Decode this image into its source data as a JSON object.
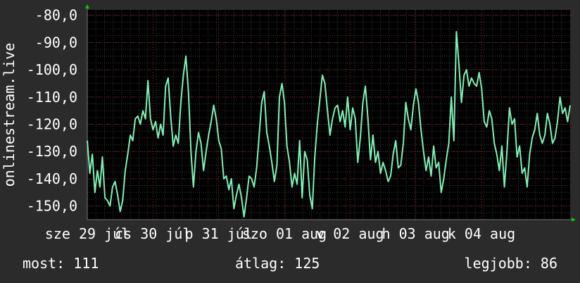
{
  "chart_data": {
    "type": "line",
    "ylabel": "onlinestream.live",
    "ylim": [
      -155,
      -78
    ],
    "y_ticks": [
      -80,
      -90,
      -100,
      -110,
      -120,
      -130,
      -140,
      -150
    ],
    "y_tick_labels": [
      "-80,0",
      "-90,0",
      "-100,0",
      "-110,0",
      "-120,0",
      "-130,0",
      "-140,0",
      "-150,0"
    ],
    "x_tick_labels": [
      "sze 29 júl",
      "cs 30 júl",
      "p 31 júl",
      "szo 01 aug",
      "v 02 aug",
      "h 03 aug",
      "k 04 aug"
    ],
    "grid": true,
    "series": [
      {
        "color": "#7ef2b6",
        "values": [
          -126,
          -138,
          -131,
          -145,
          -137,
          -143,
          -132,
          -147,
          -148,
          -150,
          -143,
          -141,
          -146,
          -152,
          -148,
          -137,
          -131,
          -124,
          -126,
          -118,
          -117,
          -120,
          -115,
          -118,
          -104,
          -118,
          -122,
          -119,
          -125,
          -120,
          -124,
          -106,
          -103,
          -117,
          -128,
          -124,
          -127,
          -112,
          -102,
          -95,
          -108,
          -130,
          -143,
          -130,
          -123,
          -127,
          -137,
          -130,
          -124,
          -119,
          -113,
          -118,
          -126,
          -129,
          -140,
          -139,
          -144,
          -140,
          -151,
          -146,
          -142,
          -147,
          -154,
          -147,
          -139,
          -140,
          -143,
          -136,
          -124,
          -112,
          -108,
          -123,
          -128,
          -134,
          -141,
          -135,
          -110,
          -105,
          -112,
          -128,
          -134,
          -143,
          -138,
          -142,
          -126,
          -147,
          -130,
          -133,
          -146,
          -151,
          -132,
          -120,
          -111,
          -102,
          -105,
          -115,
          -124,
          -118,
          -114,
          -113,
          -119,
          -115,
          -121,
          -110,
          -122,
          -114,
          -118,
          -134,
          -125,
          -112,
          -106,
          -118,
          -133,
          -124,
          -134,
          -130,
          -138,
          -134,
          -137,
          -141,
          -139,
          -131,
          -126,
          -136,
          -135,
          -127,
          -112,
          -118,
          -122,
          -113,
          -107,
          -112,
          -122,
          -130,
          -137,
          -132,
          -139,
          -128,
          -136,
          -134,
          -145,
          -140,
          -133,
          -127,
          -110,
          -126,
          -86,
          -98,
          -112,
          -102,
          -100,
          -106,
          -103,
          -105,
          -106,
          -101,
          -107,
          -119,
          -121,
          -115,
          -118,
          -127,
          -131,
          -137,
          -128,
          -143,
          -130,
          -114,
          -120,
          -118,
          -132,
          -128,
          -138,
          -136,
          -143,
          -131,
          -125,
          -122,
          -116,
          -124,
          -127,
          -124,
          -116,
          -120,
          -127,
          -125,
          -119,
          -110,
          -116,
          -114,
          -119,
          -113
        ]
      }
    ]
  },
  "stats": {
    "now": "most: 111",
    "avg": "átlag: 125",
    "best": "legjobb: 86"
  },
  "colors": {
    "background": "#2b2b2b",
    "plot_background": "#000000",
    "line": "#7ef2b6",
    "text": "#ffffff",
    "grid": "#3a3a3a",
    "minor_grid": "#5a1f1f",
    "axis_arrow": "#00cc00"
  }
}
